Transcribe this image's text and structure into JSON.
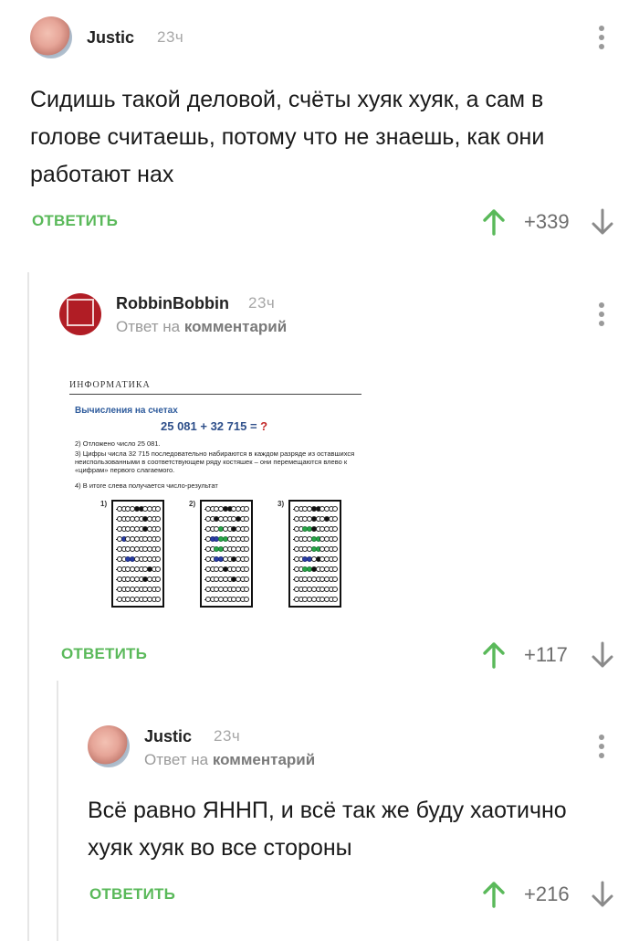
{
  "comments": [
    {
      "username": "Justic",
      "time": "23ч",
      "text": "Сидишь такой деловой, счёты хуяк хуяк, а сам в голове считаешь, потому что не знаешь, как они работают нах",
      "reply_label": "ОТВЕТИТЬ",
      "score": "+339"
    },
    {
      "username": "RobbinBobbin",
      "time": "23ч",
      "reply_to_prefix": "Ответ на",
      "reply_to_target": "комментарий",
      "image": {
        "header": "ИНФОРМАТИКА",
        "subtitle": "Вычисления на счетах",
        "equation_left": "25 081 + 32 715 =",
        "equation_q": "?",
        "step2": "2) Отложено число 25 081.",
        "step3": "3) Цифры числа 32 715 последовательно набираются в каждом разряде из оставшихся неиспользованными в соответствующем ряду костяшек – они перемещаются влево к «цифрам» первого слагаемого.",
        "step4": "4) В итоге слева получается число-результат",
        "labels": [
          "1)",
          "2)",
          "3)"
        ]
      },
      "reply_label": "ОТВЕТИТЬ",
      "score": "+117"
    },
    {
      "username": "Justic",
      "time": "23ч",
      "reply_to_prefix": "Ответ на",
      "reply_to_target": "комментарий",
      "text": "Всё равно ЯННП, и всё так же буду хаотично хуяк хуяк во все стороны",
      "reply_label": "ОТВЕТИТЬ",
      "score": "+216"
    }
  ],
  "colors": {
    "reply_green": "#5ab95a",
    "vote_up_green": "#5ab95a",
    "vote_down_gray": "#8a8a8a",
    "avatar_red": "#b11d25"
  },
  "icons": [
    "kebab-menu-icon",
    "arrow-up-icon",
    "arrow-down-icon"
  ]
}
